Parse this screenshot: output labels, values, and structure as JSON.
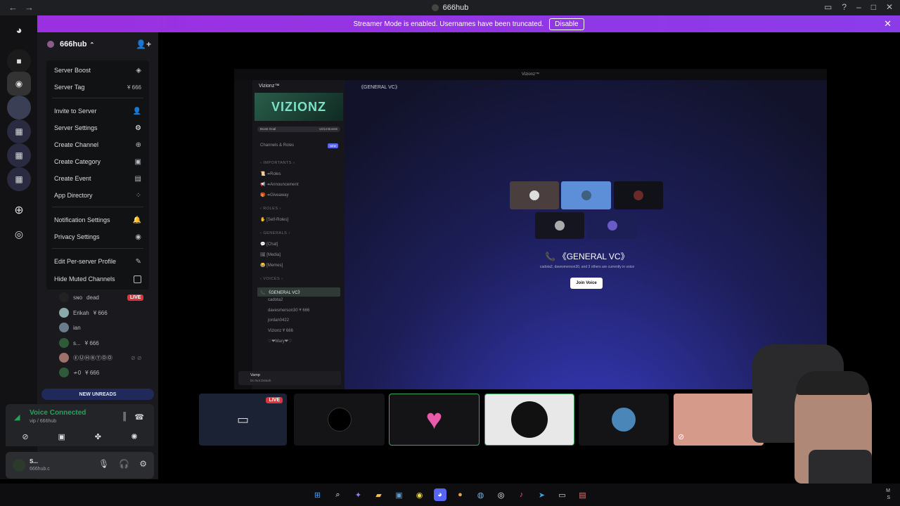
{
  "window": {
    "title": "666hub"
  },
  "banner": {
    "text": "Streamer Mode is enabled. Usernames have been truncated.",
    "button": "Disable"
  },
  "server": {
    "name": "666hub"
  },
  "menu": {
    "items": [
      {
        "label": "Server Boost",
        "icon": "boost-icon"
      },
      {
        "label": "Server Tag",
        "value": "Ұ 666"
      },
      {
        "label": "Invite to Server",
        "icon": "invite-icon"
      },
      {
        "label": "Server Settings",
        "icon": "gear-icon"
      },
      {
        "label": "Create Channel",
        "icon": "plus-circle-icon"
      },
      {
        "label": "Create Category",
        "icon": "folder-plus-icon"
      },
      {
        "label": "Create Event",
        "icon": "calendar-plus-icon"
      },
      {
        "label": "App Directory",
        "icon": "apps-icon"
      },
      {
        "label": "Notification Settings",
        "icon": "bell-icon"
      },
      {
        "label": "Privacy Settings",
        "icon": "shield-icon"
      },
      {
        "label": "Edit Per-server Profile",
        "icon": "pencil-icon"
      },
      {
        "label": "Hide Muted Channels",
        "icon": "checkbox"
      }
    ]
  },
  "members": [
    {
      "name": "ꜱɴᴏ",
      "tag": "dead",
      "live": "LIVE"
    },
    {
      "name": "Erikah",
      "tag": "Ұ 666"
    },
    {
      "name": "ian"
    },
    {
      "name": "s...",
      "tag": "Ұ 666"
    },
    {
      "name": "ⒺⓊⒽⒷⓉⓄⓄ"
    },
    {
      "name": "≁0",
      "tag": "Ұ 666"
    }
  ],
  "new_unreads": "NEW UNREADS",
  "voice": {
    "title": "Voice Connected",
    "subtitle": "vip / 666hub"
  },
  "user": {
    "name": "S...",
    "status": "666hub.c"
  },
  "stream": {
    "window_title": "Vizionz™",
    "server_name": "Vizionz™",
    "banner": "VIZIONZ",
    "header_channel": "《GENERAL VC》",
    "boost_label": "Boost Goal",
    "boosts": "14/14 Boosts",
    "channels_roles": "Channels & Roles",
    "new_badge": "NEW",
    "channels": [
      {
        "label": "‹ IMPORTANTS ›",
        "type": "cat"
      },
      {
        "label": "📜 ↠Roles",
        "type": "ch"
      },
      {
        "label": "📢 ↠Announcement",
        "type": "ch"
      },
      {
        "label": "🎁 ↠Giveaway",
        "type": "ch"
      },
      {
        "label": "‹ ROLES ›",
        "type": "cat"
      },
      {
        "label": "✋ [Self-Roles]",
        "type": "ch"
      },
      {
        "label": "‹ GENERALS ›",
        "type": "cat"
      },
      {
        "label": "💬 [Chat]",
        "type": "ch"
      },
      {
        "label": "🖼 [Media]",
        "type": "ch"
      },
      {
        "label": "😂 [Memes]",
        "type": "ch"
      },
      {
        "label": "‹ VOICES ›",
        "type": "cat"
      },
      {
        "label": "📞 《GENERAL VC》",
        "type": "active"
      },
      {
        "label": "cadota2",
        "type": "user"
      },
      {
        "label": "davesmerson30 Ұ 666",
        "type": "user"
      },
      {
        "label": "jordan0422",
        "type": "user"
      },
      {
        "label": "Vizionz Ұ 666",
        "type": "user"
      },
      {
        "label": "♡❤Mary❤♡",
        "type": "user"
      }
    ],
    "vc_title": "《GENERAL VC》",
    "vc_sub": "cadota2, davesmerson30, and 3 others are currently in voice",
    "join": "Join Voice",
    "inner_user": "Vamp",
    "inner_status": "Do Not Disturb"
  },
  "strip_live": "LIVE",
  "clock": {
    "line1": "M",
    "line2": "S"
  },
  "colors": {
    "accent": "#5865f2",
    "banner": "#9b30e0",
    "live": "#da373c",
    "voice_green": "#23a55a"
  }
}
